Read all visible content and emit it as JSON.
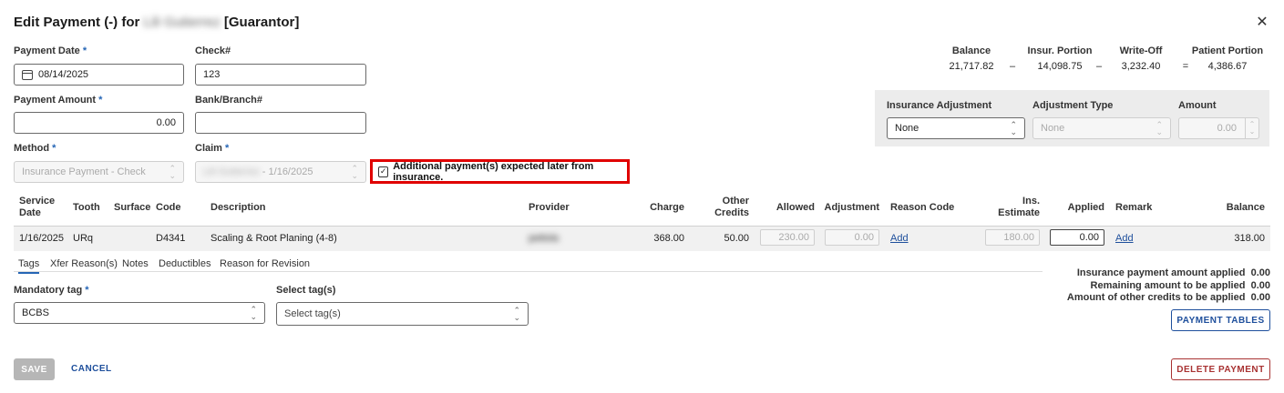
{
  "dialog": {
    "title_prefix": "Edit Payment (-) for",
    "title_name": "Lili Gutierrez",
    "title_suffix": "[Guarantor]",
    "close_glyph": "✕"
  },
  "form": {
    "payment_date": {
      "label": "Payment Date",
      "value": "08/14/2025"
    },
    "check_no": {
      "label": "Check#",
      "value": "123"
    },
    "payment_amount": {
      "label": "Payment Amount",
      "value": "0.00"
    },
    "bank_branch": {
      "label": "Bank/Branch#",
      "value": ""
    },
    "method": {
      "label": "Method",
      "value": "Insurance Payment - Check"
    },
    "claim": {
      "label": "Claim",
      "name": "Lili Gutierrez",
      "date": " - 1/16/2025"
    },
    "additional_payment": {
      "label": "Additional payment(s) expected later from insurance.",
      "checked": true
    },
    "required_marker": "*"
  },
  "summary": {
    "balance_label": "Balance",
    "balance": "21,717.82",
    "insur_label": "Insur. Portion",
    "insur": "14,098.75",
    "writeoff_label": "Write-Off",
    "writeoff": "3,232.40",
    "patient_label": "Patient Portion",
    "patient": "4,386.67",
    "minus": "–",
    "equals": "="
  },
  "adjustment": {
    "ins_adj_label": "Insurance Adjustment",
    "ins_adj_value": "None",
    "adj_type_label": "Adjustment Type",
    "adj_type_value": "None",
    "amount_label": "Amount",
    "amount_value": "0.00"
  },
  "table": {
    "headers": {
      "service_date_1": "Service",
      "service_date_2": "Date",
      "tooth": "Tooth",
      "surface": "Surface",
      "code": "Code",
      "description": "Description",
      "provider": "Provider",
      "charge": "Charge",
      "other_credits_1": "Other",
      "other_credits_2": "Credits",
      "allowed": "Allowed",
      "adjustment": "Adjustment",
      "reason_code": "Reason Code",
      "ins_estimate_1": "Ins.",
      "ins_estimate_2": "Estimate",
      "applied": "Applied",
      "remark": "Remark",
      "balance": "Balance"
    },
    "row": {
      "service_date": "1/16/2025",
      "tooth": "URq",
      "surface": "",
      "code": "D4341",
      "description": "Scaling & Root Planing (4-8)",
      "provider": "pettola",
      "charge": "368.00",
      "other_credits": "50.00",
      "allowed": "230.00",
      "adjustment": "0.00",
      "reason_code": "Add",
      "ins_estimate": "180.00",
      "applied": "0.00",
      "remark": "Add",
      "balance": "318.00"
    }
  },
  "tabs": [
    "Tags",
    "Xfer Reason(s)",
    "Notes",
    "Deductibles",
    "Reason for Revision"
  ],
  "tags": {
    "mandatory_label": "Mandatory tag",
    "mandatory_value": "BCBS",
    "select_label": "Select tag(s)",
    "select_placeholder": "Select tag(s)"
  },
  "totals": {
    "ins_applied_label": "Insurance payment amount applied",
    "ins_applied": "0.00",
    "remaining_label": "Remaining amount to be applied",
    "remaining": "0.00",
    "other_credits_label": "Amount of other credits to be applied",
    "other_credits": "0.00"
  },
  "buttons": {
    "payment_tables": "PAYMENT TABLES",
    "save": "SAVE",
    "cancel": "CANCEL",
    "delete": "DELETE PAYMENT"
  },
  "colors": {
    "accent": "#1e4f9c",
    "highlight": "#e00000",
    "delete": "#a83232"
  }
}
